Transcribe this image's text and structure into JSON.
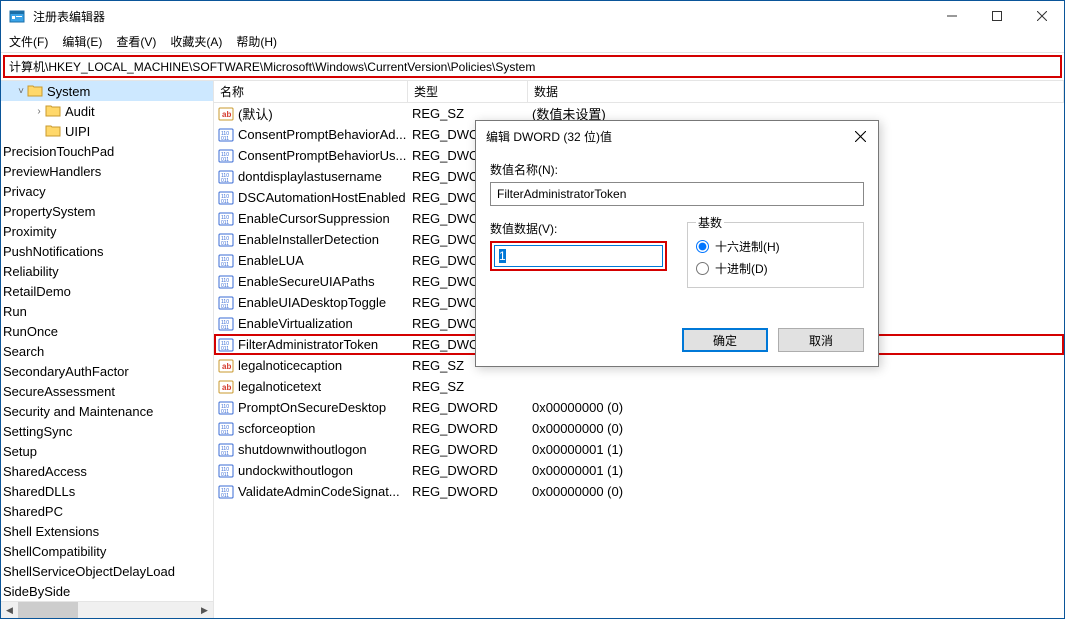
{
  "app": {
    "title": "注册表编辑器"
  },
  "winbtns": {
    "min": "minimize",
    "max": "maximize",
    "close": "close"
  },
  "menu": {
    "file": "文件(F)",
    "edit": "编辑(E)",
    "view": "查看(V)",
    "fav": "收藏夹(A)",
    "help": "帮助(H)"
  },
  "address": {
    "path": "计算机\\HKEY_LOCAL_MACHINE\\SOFTWARE\\Microsoft\\Windows\\CurrentVersion\\Policies\\System"
  },
  "tree": {
    "system": "System",
    "audit": "Audit",
    "uipi": "UIPI",
    "items": [
      "PrecisionTouchPad",
      "PreviewHandlers",
      "Privacy",
      "PropertySystem",
      "Proximity",
      "PushNotifications",
      "Reliability",
      "RetailDemo",
      "Run",
      "RunOnce",
      "Search",
      "SecondaryAuthFactor",
      "SecureAssessment",
      "Security and Maintenance",
      "SettingSync",
      "Setup",
      "SharedAccess",
      "SharedDLLs",
      "SharedPC",
      "Shell Extensions",
      "ShellCompatibility",
      "ShellServiceObjectDelayLoad",
      "SideBySide"
    ]
  },
  "cols": {
    "name": "名称",
    "type": "类型",
    "data": "数据"
  },
  "rows": [
    {
      "icon": "str",
      "name": "(默认)",
      "type": "REG_SZ",
      "data": "(数值未设置)"
    },
    {
      "icon": "bin",
      "name": "ConsentPromptBehaviorAd...",
      "type": "REG_DWORD",
      "data": ""
    },
    {
      "icon": "bin",
      "name": "ConsentPromptBehaviorUs...",
      "type": "REG_DWO",
      "data": ""
    },
    {
      "icon": "bin",
      "name": "dontdisplaylastusername",
      "type": "REG_DWO",
      "data": ""
    },
    {
      "icon": "bin",
      "name": "DSCAutomationHostEnabled",
      "type": "REG_DWO",
      "data": ""
    },
    {
      "icon": "bin",
      "name": "EnableCursorSuppression",
      "type": "REG_DWO",
      "data": ""
    },
    {
      "icon": "bin",
      "name": "EnableInstallerDetection",
      "type": "REG_DWO",
      "data": ""
    },
    {
      "icon": "bin",
      "name": "EnableLUA",
      "type": "REG_DWO",
      "data": ""
    },
    {
      "icon": "bin",
      "name": "EnableSecureUIAPaths",
      "type": "REG_DWO",
      "data": ""
    },
    {
      "icon": "bin",
      "name": "EnableUIADesktopToggle",
      "type": "REG_DWO",
      "data": ""
    },
    {
      "icon": "bin",
      "name": "EnableVirtualization",
      "type": "REG_DWO",
      "data": ""
    },
    {
      "icon": "bin",
      "name": "FilterAdministratorToken",
      "type": "REG_DWO",
      "data": "",
      "hl": true
    },
    {
      "icon": "str",
      "name": "legalnoticecaption",
      "type": "REG_SZ",
      "data": ""
    },
    {
      "icon": "str",
      "name": "legalnoticetext",
      "type": "REG_SZ",
      "data": ""
    },
    {
      "icon": "bin",
      "name": "PromptOnSecureDesktop",
      "type": "REG_DWORD",
      "data": "0x00000000 (0)"
    },
    {
      "icon": "bin",
      "name": "scforceoption",
      "type": "REG_DWORD",
      "data": "0x00000000 (0)"
    },
    {
      "icon": "bin",
      "name": "shutdownwithoutlogon",
      "type": "REG_DWORD",
      "data": "0x00000001 (1)"
    },
    {
      "icon": "bin",
      "name": "undockwithoutlogon",
      "type": "REG_DWORD",
      "data": "0x00000001 (1)"
    },
    {
      "icon": "bin",
      "name": "ValidateAdminCodeSignat...",
      "type": "REG_DWORD",
      "data": "0x00000000 (0)"
    }
  ],
  "dialog": {
    "title": "编辑 DWORD (32 位)值",
    "name_label": "数值名称(N):",
    "name_value": "FilterAdministratorToken",
    "data_label": "数值数据(V):",
    "data_value": "1",
    "base_label": "基数",
    "radio_hex": "十六进制(H)",
    "radio_dec": "十进制(D)",
    "ok": "确定",
    "cancel": "取消"
  }
}
